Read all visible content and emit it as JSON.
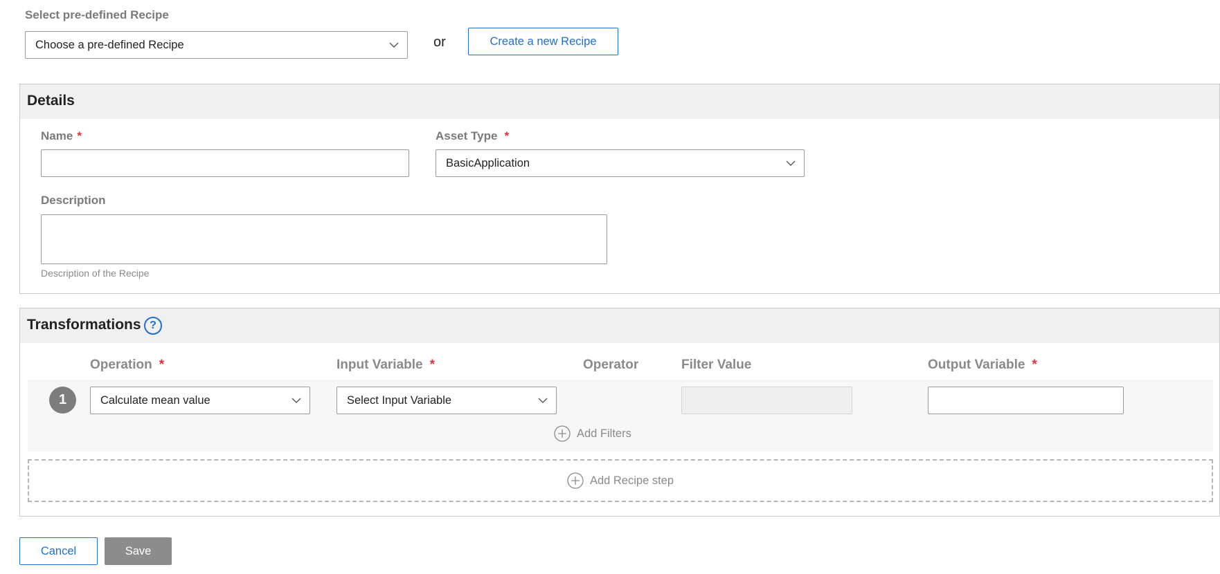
{
  "recipe_select": {
    "label": "Select pre-defined Recipe",
    "selected": "Choose a pre-defined Recipe"
  },
  "or_text": "or",
  "create_button": "Create a new Recipe",
  "details": {
    "title": "Details",
    "name_label": "Name",
    "name_value": "",
    "required_mark": "*",
    "asset_type_label": "Asset Type",
    "asset_type_selected": "BasicApplication",
    "description_label": "Description",
    "description_value": "",
    "description_hint": "Description of the Recipe"
  },
  "transformations": {
    "title": "Transformations",
    "help_icon": "question-circle-icon",
    "columns": {
      "operation": "Operation",
      "input_variable": "Input Variable",
      "operator": "Operator",
      "filter_value": "Filter Value",
      "output_variable": "Output Variable"
    },
    "steps": [
      {
        "number": "1",
        "operation": "Calculate mean value",
        "input_variable": "Select Input Variable",
        "filter_value": "",
        "output_variable": ""
      }
    ],
    "add_filters": "Add Filters",
    "add_step": "Add Recipe step"
  },
  "footer": {
    "cancel": "Cancel",
    "save": "Save"
  },
  "colors": {
    "accent": "#1f6fd1",
    "required": "#e0323a",
    "save_disabled": "#8c8c8c",
    "panel_header": "#f0f0f0"
  }
}
